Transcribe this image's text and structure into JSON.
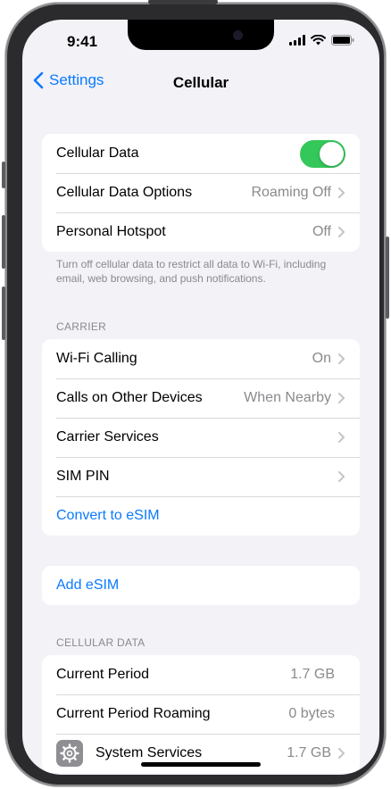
{
  "status_bar": {
    "time": "9:41"
  },
  "nav": {
    "back_label": "Settings",
    "title": "Cellular"
  },
  "group1": {
    "cellular_data_label": "Cellular Data",
    "cellular_data_on": true,
    "options_label": "Cellular Data Options",
    "options_value": "Roaming Off",
    "hotspot_label": "Personal Hotspot",
    "hotspot_value": "Off"
  },
  "group1_footnote": "Turn off cellular data to restrict all data to Wi-Fi, including email, web browsing, and push notifications.",
  "carrier": {
    "header": "CARRIER",
    "wifi_calling_label": "Wi-Fi Calling",
    "wifi_calling_value": "On",
    "other_devices_label": "Calls on Other Devices",
    "other_devices_value": "When Nearby",
    "carrier_services_label": "Carrier Services",
    "sim_pin_label": "SIM PIN",
    "convert_esim_label": "Convert to eSIM"
  },
  "add_esim_label": "Add eSIM",
  "cellular_data_section": {
    "header": "CELLULAR DATA",
    "current_period_label": "Current Period",
    "current_period_value": "1.7 GB",
    "roaming_label": "Current Period Roaming",
    "roaming_value": "0 bytes",
    "system_services_label": "System Services",
    "system_services_value": "1.7 GB"
  },
  "colors": {
    "accent": "#0a7aff",
    "toggle_on": "#34c759",
    "background": "#f2f2f7",
    "secondary_text": "#8a8a8e"
  },
  "icons": [
    "back-chevron-icon",
    "signal-icon",
    "wifi-icon",
    "battery-icon",
    "chevron-right-icon",
    "gear-icon"
  ]
}
